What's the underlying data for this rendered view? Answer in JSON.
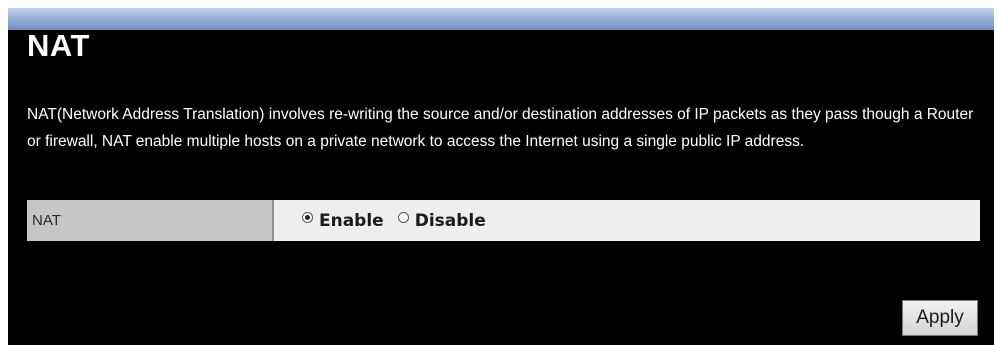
{
  "page": {
    "title": "NAT",
    "description": "NAT(Network Address Translation) involves re-writing the source and/or destination addresses of IP packets as they pass though a Router or firewall, NAT enable multiple hosts on a private network to access the Internet using a single public IP address."
  },
  "nat_setting": {
    "label": "NAT",
    "options": [
      {
        "label": "Enable",
        "selected": true
      },
      {
        "label": "Disable",
        "selected": false
      }
    ]
  },
  "actions": {
    "apply_label": "Apply"
  },
  "colors": {
    "background": "#000000",
    "header_bar": "#8fa8d4",
    "label_cell": "#c6c6c6",
    "value_cell": "#eeeeee",
    "text": "#ffffff"
  }
}
